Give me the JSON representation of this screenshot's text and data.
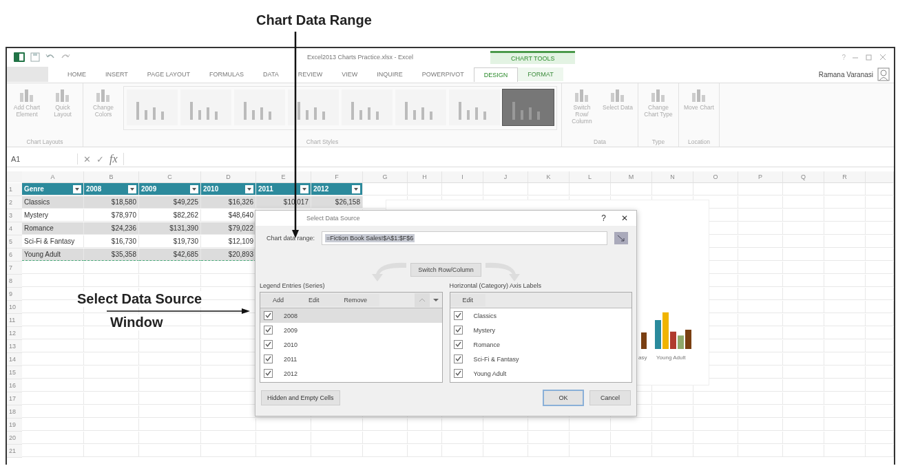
{
  "annotations": {
    "range_label": "Chart Data Range",
    "dialog_label": [
      "Select Data Source",
      "Window"
    ]
  },
  "title_bar": {
    "title": "Excel2013 Charts Practice.xlsx - Excel",
    "context_tab": "CHART TOOLS",
    "user": "Ramana Varanasi",
    "help": "?"
  },
  "tabs": [
    {
      "label": "HOME",
      "selected": false
    },
    {
      "label": "INSERT",
      "selected": false
    },
    {
      "label": "PAGE LAYOUT",
      "selected": false
    },
    {
      "label": "FORMULAS",
      "selected": false
    },
    {
      "label": "DATA",
      "selected": false
    },
    {
      "label": "REVIEW",
      "selected": false
    },
    {
      "label": "VIEW",
      "selected": false
    },
    {
      "label": "INQUIRE",
      "selected": false
    },
    {
      "label": "POWERPIVOT",
      "selected": false
    },
    {
      "label": "DESIGN",
      "selected": true
    },
    {
      "label": "FORMAT",
      "selected": false
    }
  ],
  "ribbon": {
    "groups": [
      {
        "label": "Chart Layouts",
        "commands": [
          "Add Chart Element",
          "Quick Layout"
        ]
      },
      {
        "label": "Chart Styles",
        "commands": [
          "Change Colors"
        ],
        "styles": [
          {
            "selected": false
          },
          {
            "selected": false
          },
          {
            "selected": false
          },
          {
            "selected": false
          },
          {
            "selected": false
          },
          {
            "selected": false
          },
          {
            "selected": false
          },
          {
            "selected": true
          }
        ]
      },
      {
        "label": "Data",
        "commands": [
          "Switch Row/ Column",
          "Select Data"
        ]
      },
      {
        "label": "Type",
        "commands": [
          "Change Chart Type"
        ]
      },
      {
        "label": "Location",
        "commands": [
          "Move Chart"
        ]
      }
    ]
  },
  "formula_bar": {
    "name_box": "A1",
    "cancel": "✕",
    "enter": "✓",
    "fx": "fx"
  },
  "sheet": {
    "columns": [
      "A",
      "B",
      "C",
      "D",
      "E",
      "F",
      "G",
      "H",
      "I",
      "J",
      "K",
      "L",
      "M",
      "N",
      "O",
      "P",
      "Q",
      "R"
    ],
    "row_numbers": [
      "1",
      "2",
      "3",
      "4",
      "5",
      "6",
      "7",
      "8",
      "9",
      "10",
      "11",
      "12",
      "13",
      "14",
      "15",
      "16",
      "17",
      "18",
      "19",
      "20",
      "21"
    ],
    "header": [
      "Genre",
      "2008",
      "2009",
      "2010",
      "2011",
      "2012"
    ],
    "rows": [
      [
        "Classics",
        "$18,580",
        "$49,225",
        "$16,326",
        "$10,017",
        "$26,158"
      ],
      [
        "Mystery",
        "$78,970",
        "$82,262",
        "$48,640"
      ],
      [
        "Romance",
        "$24,236",
        "$131,390",
        "$79,022"
      ],
      [
        "Sci-Fi & Fantasy",
        "$16,730",
        "$19,730",
        "$12,109"
      ],
      [
        "Young Adult",
        "$35,358",
        "$42,685",
        "$20,893"
      ]
    ]
  },
  "chart": {
    "category_labels": [
      "asy",
      "Young Adult"
    ]
  },
  "dialog": {
    "title": "Select Data Source",
    "help": "?",
    "close": "✕",
    "range_label": "Chart data range:",
    "range_value": "=Fiction Book Sales!$A$1:$F$6",
    "switch_button": "Switch Row/Column",
    "legend": {
      "label": "Legend Entries (Series)",
      "buttons": [
        "Add",
        "Edit",
        "Remove"
      ],
      "items": [
        {
          "label": "2008",
          "checked": true,
          "selected": true
        },
        {
          "label": "2009",
          "checked": true,
          "selected": false
        },
        {
          "label": "2010",
          "checked": true,
          "selected": false
        },
        {
          "label": "2011",
          "checked": true,
          "selected": false
        },
        {
          "label": "2012",
          "checked": true,
          "selected": false
        }
      ]
    },
    "axis": {
      "label": "Horizontal (Category) Axis Labels",
      "buttons": [
        "Edit"
      ],
      "items": [
        {
          "label": "Classics",
          "checked": true,
          "selected": false
        },
        {
          "label": "Mystery",
          "checked": true,
          "selected": false
        },
        {
          "label": "Romance",
          "checked": true,
          "selected": false
        },
        {
          "label": "Sci-Fi & Fantasy",
          "checked": true,
          "selected": false
        },
        {
          "label": "Young Adult",
          "checked": true,
          "selected": false
        }
      ]
    },
    "hidden_button": "Hidden and Empty Cells",
    "ok": "OK",
    "cancel": "Cancel"
  }
}
